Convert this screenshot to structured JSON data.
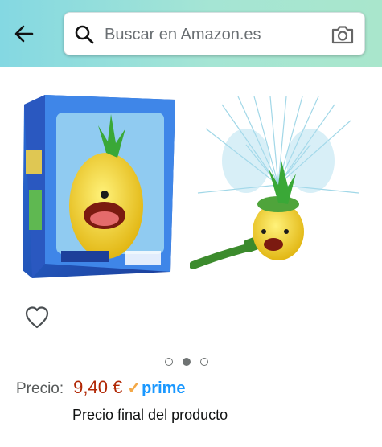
{
  "header": {
    "back_icon": "arrow-left-icon",
    "search_placeholder": "Buscar en Amazon.es",
    "search_icon": "search-icon",
    "camera_icon": "camera-icon",
    "colors": {
      "gradient_start": "#84d8e2",
      "gradient_end": "#a9e6cc"
    }
  },
  "gallery": {
    "images": [
      {
        "alt": "product-box-image"
      },
      {
        "alt": "product-in-use-image"
      }
    ],
    "current_index": 2,
    "total": 3,
    "wishlist_icon": "heart-icon"
  },
  "product": {
    "price_label": "Precio:",
    "price_value": "9,40 €",
    "prime_label": "prime",
    "price_note": "Precio final del producto",
    "colors": {
      "price": "#b12704",
      "prime": "#1a98ff",
      "prime_check": "#f3a847"
    }
  }
}
